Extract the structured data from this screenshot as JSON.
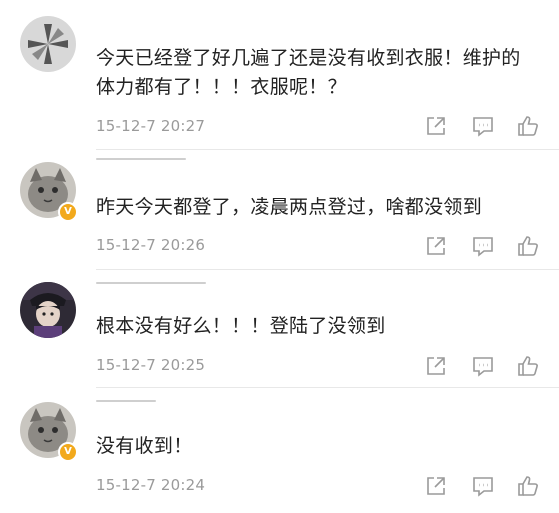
{
  "comments": [
    {
      "text": "今天已经登了好几遍了还是没有收到衣服！维护的体力都有了！！！衣服呢！？",
      "time": "15-12-7 20:27",
      "verified": false
    },
    {
      "text": "昨天今天都登了，凌晨两点登过，啥都没领到",
      "time": "15-12-7 20:26",
      "verified": true
    },
    {
      "text": "根本没有好么！！！登陆了没领到",
      "time": "15-12-7 20:25",
      "verified": false
    },
    {
      "text": "没有收到！",
      "time": "15-12-7 20:24",
      "verified": true
    }
  ],
  "icons": {
    "share": "share-icon",
    "comment": "comment-icon",
    "like": "like-icon"
  },
  "colors": {
    "text": "#222222",
    "meta": "#9a9a9a",
    "icon": "#9a9a9a",
    "badge": "#f2a91c"
  }
}
